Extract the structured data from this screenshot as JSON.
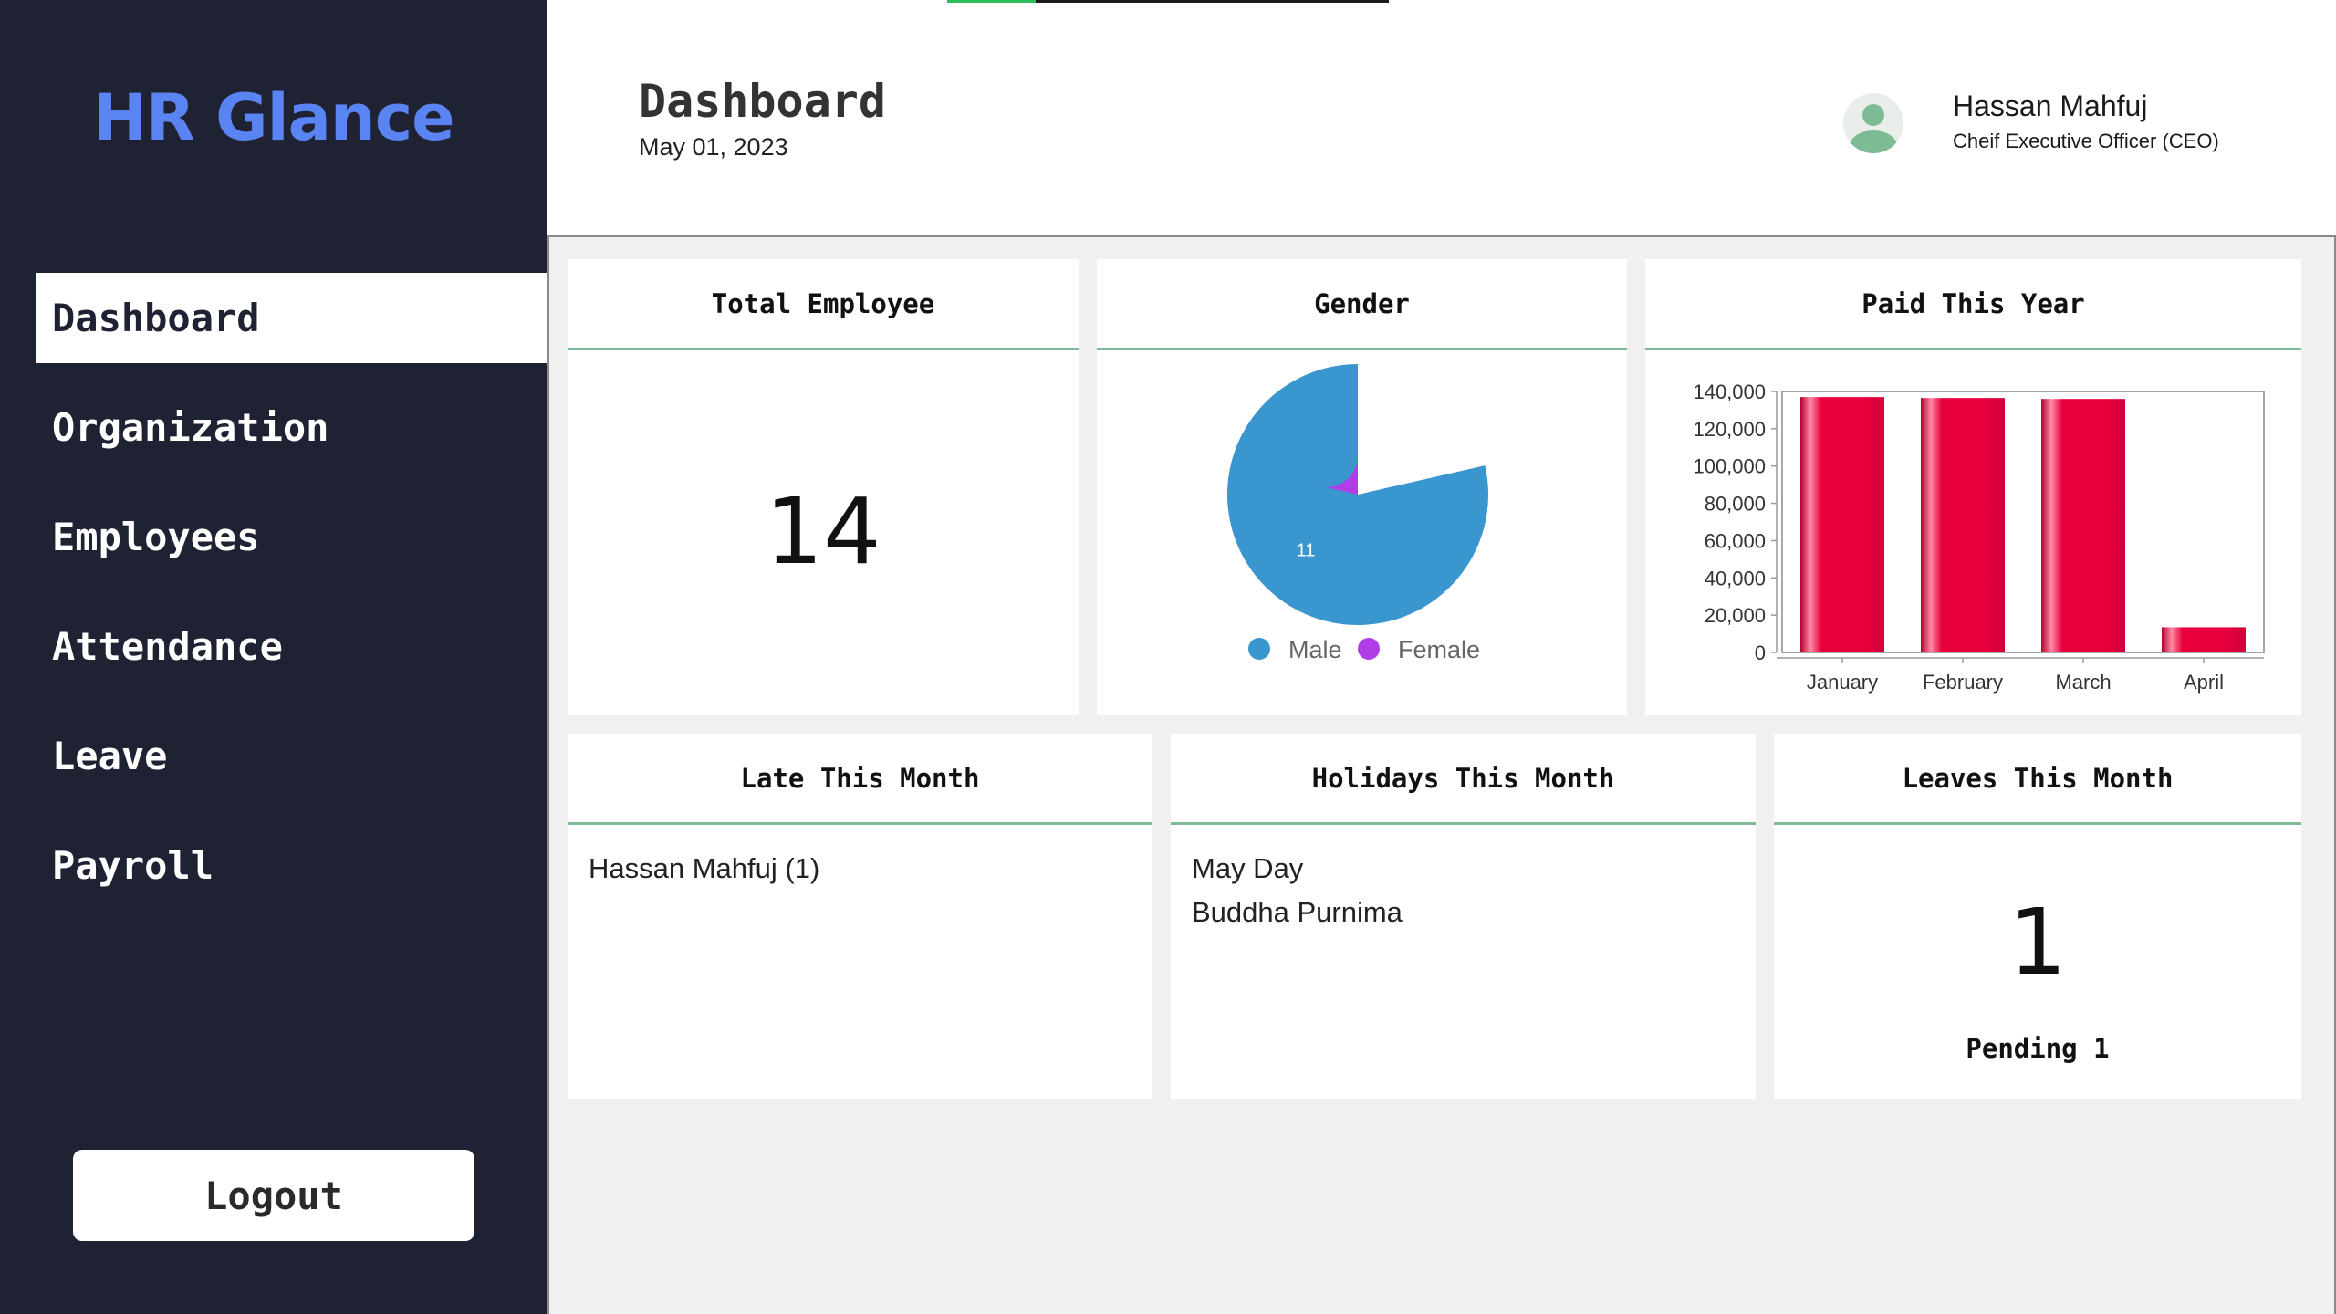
{
  "app": {
    "title": "HR Glance"
  },
  "sidebar": {
    "items": [
      {
        "label": "Dashboard",
        "active": true
      },
      {
        "label": "Organization"
      },
      {
        "label": "Employees"
      },
      {
        "label": "Attendance"
      },
      {
        "label": "Leave"
      },
      {
        "label": "Payroll"
      }
    ],
    "logout_label": "Logout"
  },
  "header": {
    "title": "Dashboard",
    "date": "May 01, 2023",
    "user_name": "Hassan Mahfuj",
    "user_role": "Cheif Executive Officer (CEO)",
    "avatar_icon": "user-avatar-icon",
    "loading_progress": 0.2
  },
  "cards": {
    "total_employee": {
      "title": "Total Employee",
      "value": "14"
    },
    "gender": {
      "title": "Gender"
    },
    "paid": {
      "title": "Paid This Year"
    },
    "late": {
      "title": "Late This Month",
      "items": [
        "Hassan Mahfuj (1)"
      ]
    },
    "holidays": {
      "title": "Holidays This Month",
      "items": [
        "May Day",
        "Buddha Purnima"
      ]
    },
    "leaves": {
      "title": "Leaves This Month",
      "value": "1",
      "pending": "Pending 1"
    }
  },
  "colors": {
    "sidebar_bg": "#1e2233",
    "brand": "#5b84f3",
    "accent_line": "#7dbb95",
    "male": "#3a96cf",
    "female": "#b03ee8",
    "bar": "#e8003c"
  },
  "chart_data": [
    {
      "type": "pie",
      "title": "Gender",
      "labels": [
        "Male",
        "Female"
      ],
      "values": [
        11,
        3
      ],
      "legend": "bottom",
      "colors": [
        "#3a96cf",
        "#b03ee8"
      ]
    },
    {
      "type": "bar",
      "title": "Paid This Year",
      "categories": [
        "January",
        "February",
        "March",
        "April"
      ],
      "values": [
        137000,
        136500,
        136000,
        13500
      ],
      "ylim": [
        0,
        140000
      ],
      "yticks": [
        0,
        20000,
        40000,
        60000,
        80000,
        100000,
        120000,
        140000
      ],
      "ytick_labels": [
        "0",
        "20,000",
        "40,000",
        "60,000",
        "80,000",
        "100,000",
        "120,000",
        "140,000"
      ],
      "grid": false,
      "colors": [
        "#e8003c"
      ]
    }
  ]
}
